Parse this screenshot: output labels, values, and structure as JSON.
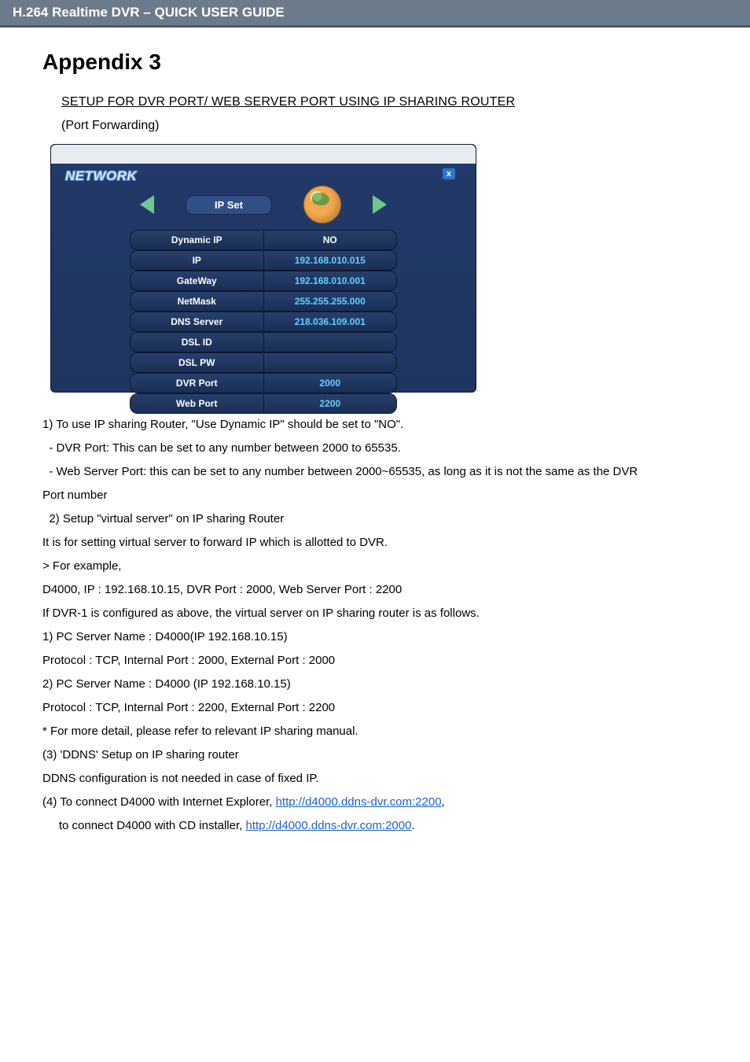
{
  "header": {
    "title": "H.264 Realtime DVR – QUICK USER GUIDE"
  },
  "heading": "Appendix 3",
  "subtitle": "SETUP FOR DVR PORT/ WEB SERVER PORT USING IP SHARING ROUTER",
  "subtitle2": "(Port Forwarding)",
  "network": {
    "title": "NETWORK",
    "section": "IP Set",
    "close": "x",
    "rows": [
      {
        "label": "Dynamic IP",
        "value": "NO",
        "white": true
      },
      {
        "label": "IP",
        "value": "192.168.010.015"
      },
      {
        "label": "GateWay",
        "value": "192.168.010.001"
      },
      {
        "label": "NetMask",
        "value": "255.255.255.000"
      },
      {
        "label": "DNS Server",
        "value": "218.036.109.001"
      },
      {
        "label": "DSL ID",
        "value": ""
      },
      {
        "label": "DSL PW",
        "value": ""
      },
      {
        "label": "DVR Port",
        "value": "2000"
      },
      {
        "label": "Web Port",
        "value": "2200"
      }
    ]
  },
  "body": {
    "p1": "1) To use IP sharing Router, \"Use Dynamic IP\" should be set to \"NO\".",
    "p2": "  - DVR Port: This can be set to any number between 2000 to 65535.",
    "p3": "  - Web Server Port: this can be set to any number between 2000~65535, as long as it is not the same as the DVR",
    "p3b": "Port number",
    "p4": "  2) Setup \"virtual server\" on IP sharing Router",
    "p5": "It is for setting virtual server to forward IP which is allotted to DVR.",
    "p6": "> For example,",
    "p7": "D4000, IP : 192.168.10.15, DVR Port : 2000, Web Server Port : 2200",
    "p8": "If DVR-1 is configured as above, the virtual server on IP sharing router is as follows.",
    "p9": "1) PC Server Name : D4000(IP 192.168.10.15)",
    "p10": "Protocol : TCP, Internal Port : 2000, External Port : 2000",
    "p11": "2) PC Server Name : D4000 (IP 192.168.10.15)",
    "p12": "Protocol : TCP, Internal Port : 2200, External Port : 2200",
    "p13": "* For more detail, please refer to relevant IP sharing manual.",
    "p14": "(3) 'DDNS' Setup on IP sharing router",
    "p15": "DDNS configuration is not needed in case of fixed IP.",
    "p16a": "(4) To connect D4000 with Internet Explorer, ",
    "p16link": "http://d4000.ddns-dvr.com:2200",
    "p16b": ",",
    "p17a": "     to connect D4000 with CD installer, ",
    "p17link": "http://d4000.ddns-dvr.com:2000",
    "p17b": "."
  }
}
